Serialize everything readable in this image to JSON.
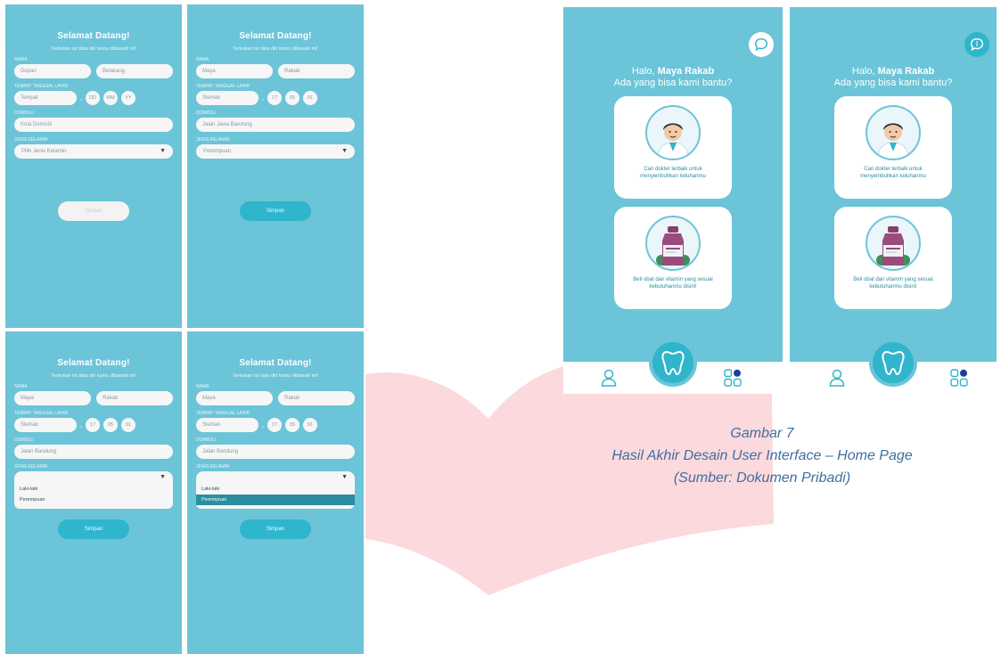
{
  "colors": {
    "screen_bg": "#6cc4d8",
    "accent": "#2fb5cc",
    "field_bg": "#f6f6f6",
    "pink_shape": "#fbd9dd",
    "caption": "#3f6fa2"
  },
  "form_screens": [
    {
      "title": "Selamat Datang!",
      "subtitle": "Tentukan isi data diri kamu dibawah ini!",
      "name_label": "NAMA",
      "first_name": "Depan",
      "last_name": "Belakang",
      "birth_label": "TEMPAT TANGGAL LAHIR",
      "birth_place": "Tempat",
      "birth_day": "DD",
      "birth_month": "MM",
      "birth_year": "YY",
      "domicile_label": "DOMISILI",
      "domicile": "Kota Domisili",
      "gender_label": "JENIS KELAMIN",
      "gender": "Pilih Jenis Kelamin",
      "submit": "Simpan"
    },
    {
      "title": "Selamat Datang!",
      "subtitle": "Tentukan isi data diri kamu dibawah ini!",
      "name_label": "NAMA",
      "first_name": "Maya",
      "last_name": "Rakab",
      "birth_label": "TEMPAT TANGGAL LAHIR",
      "birth_place": "Sleman",
      "birth_day": "17",
      "birth_month": "05",
      "birth_year": "01",
      "domicile_label": "DOMISILI",
      "domicile": "Jalan Jawa Bandung",
      "gender_label": "JENIS KELAMIN",
      "gender": "Perempuan",
      "submit": "Simpan"
    },
    {
      "title": "Selamat Datang!",
      "subtitle": "Tentukan isi data diri kamu dibawah ini!",
      "name_label": "NAMA",
      "first_name": "Maya",
      "last_name": "Rakab",
      "birth_label": "TEMPAT TANGGAL LAHIR",
      "birth_place": "Sleman",
      "birth_day": "17",
      "birth_month": "05",
      "birth_year": "01",
      "domicile_label": "DOMISILI",
      "domicile": "Jalan Bandung",
      "gender_label": "JENIS KELAMIN",
      "options": [
        "Laki-laki",
        "Perempuan"
      ],
      "submit": "Simpan"
    },
    {
      "title": "Selamat Datang!",
      "subtitle": "Tentukan isi data diri kamu dibawah ini!",
      "name_label": "NAMA",
      "first_name": "Maya",
      "last_name": "Rakab",
      "birth_label": "TEMPAT TANGGAL LAHIR",
      "birth_place": "Sleman",
      "birth_day": "17",
      "birth_month": "05",
      "birth_year": "01",
      "domicile_label": "DOMISILI",
      "domicile": "Jalan Bandung",
      "gender_label": "JENIS KELAMIN",
      "options": [
        "Laki-laki",
        "Perempuan"
      ],
      "selected_option": "Perempuan",
      "submit": "Simpan"
    }
  ],
  "home_screens": [
    {
      "greeting_prefix": "Halo, ",
      "user_name": "Maya Rakab",
      "greeting_question": "Ada yang bisa kami bantu?",
      "card_doctor_text": "Cari dokter terbaik untuk menyembuhkan keluhanmu",
      "card_product_text": "Beli obat dan vitamin yang sesuai kebutuhanmu disini!",
      "chat_icon": "chat-bubble-icon",
      "nav_left_icon": "profile-icon",
      "nav_center_icon": "tooth-icon",
      "nav_right_icon": "grid-menu-icon",
      "chat_style": "outline"
    },
    {
      "greeting_prefix": "Halo, ",
      "user_name": "Maya Rakab",
      "greeting_question": "Ada yang bisa kami bantu?",
      "card_doctor_text": "Cari dokter terbaik untuk menyembuhkan keluhanmu",
      "card_product_text": "Beli obat dan vitamin yang sesuai kebutuhanmu disini!",
      "chat_icon": "chat-bubble-icon",
      "nav_left_icon": "profile-icon",
      "nav_center_icon": "tooth-icon",
      "nav_right_icon": "grid-menu-icon",
      "chat_style": "filled"
    }
  ],
  "caption": {
    "figure": "Gambar 7",
    "title": "Hasil Akhir Desain User Interface – Home Page",
    "source": "(Sumber: Dokumen Pribadi)"
  }
}
